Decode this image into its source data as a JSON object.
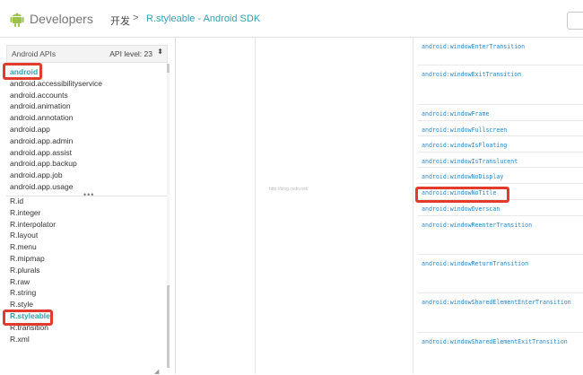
{
  "header": {
    "brand": "Developers",
    "breadcrumb_root": "开发",
    "breadcrumb_sep": ">",
    "breadcrumb_current": "R.styleable - Android SDK",
    "accent_color": "#33a0b0",
    "logo_icon": "android-robot-icon"
  },
  "sidebar": {
    "api_title": "Android APIs",
    "api_level_label": "API level: 23",
    "api_level_arrow": "⬍",
    "packages": [
      "android",
      "android.accessibilityservice",
      "android.accounts",
      "android.animation",
      "android.annotation",
      "android.app",
      "android.app.admin",
      "android.app.assist",
      "android.app.backup",
      "android.app.job",
      "android.app.usage"
    ],
    "active_package": "android",
    "divider_handle": "•••",
    "classes": [
      "R.id",
      "R.integer",
      "R.interpolator",
      "R.layout",
      "R.menu",
      "R.mipmap",
      "R.plurals",
      "R.raw",
      "R.string",
      "R.style",
      "R.styleable",
      "R.transition",
      "R.xml"
    ],
    "active_class": "R.styleable",
    "resize_corner": "◢"
  },
  "content": {
    "watermark": "http://blog.csdn.net/",
    "attributes": [
      "android:windowEnterTransition",
      "android:windowExitTransition",
      "android:windowFrame",
      "android:windowFullscreen",
      "android:windowIsFloating",
      "android:windowIsTranslucent",
      "android:windowNoDisplay",
      "android:windowNoTitle",
      "android:windowOverscan",
      "android:windowReenterTransition",
      "android:windowReturnTransition",
      "android:windowSharedElementEnterTransition",
      "android:windowSharedElementExitTransition"
    ],
    "highlighted_attribute": "android:windowNoTitle",
    "link_color": "#2e86c0"
  },
  "highlight_color": "#e23b2c"
}
